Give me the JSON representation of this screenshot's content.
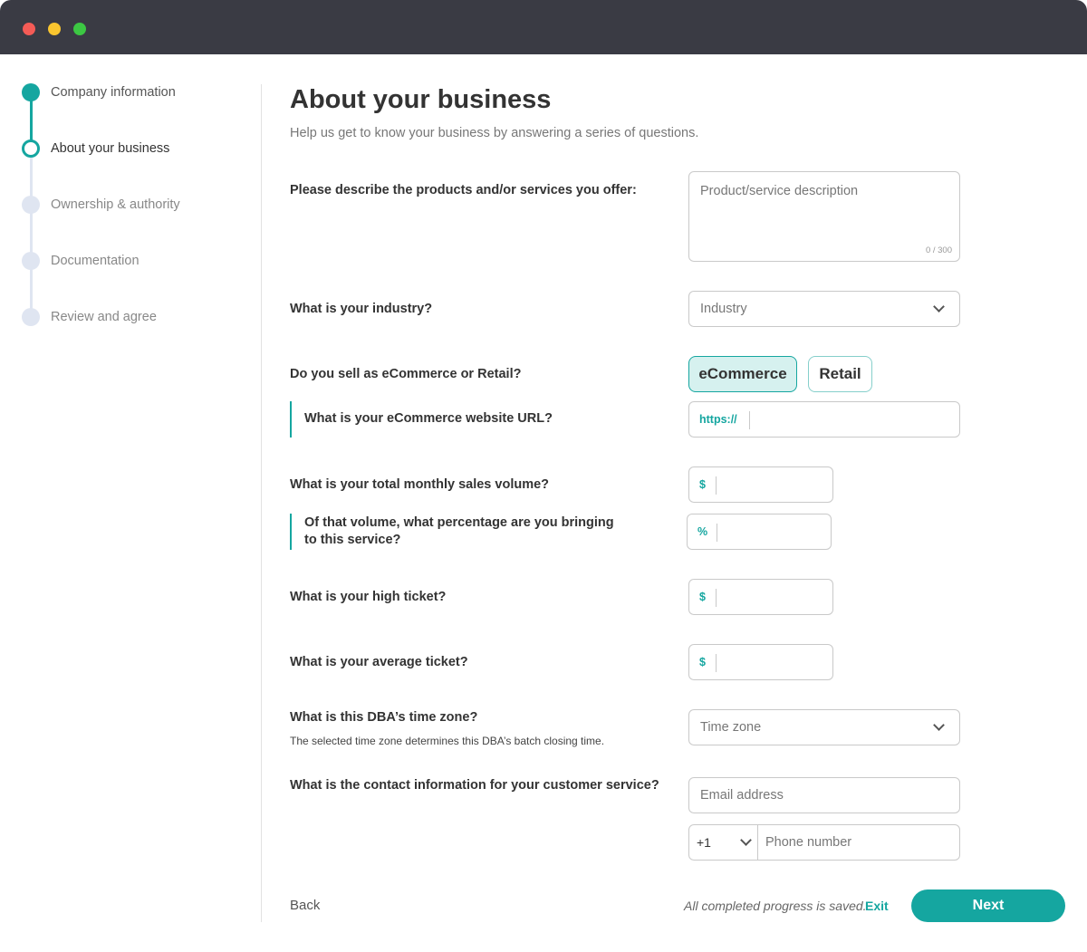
{
  "steps": [
    {
      "label": "Company information",
      "state": "done"
    },
    {
      "label": "About your business",
      "state": "current"
    },
    {
      "label": "Ownership & authority",
      "state": "todo"
    },
    {
      "label": "Documentation",
      "state": "todo"
    },
    {
      "label": "Review and agree",
      "state": "todo"
    }
  ],
  "page": {
    "title": "About your business",
    "subtitle": "Help us get to know your business by answering a series of questions."
  },
  "questions": {
    "products": "Please describe the products and/or services you offer:",
    "industry": "What is your industry?",
    "channel": "Do you sell as eCommerce or Retail?",
    "url": "What is your eCommerce website URL?",
    "monthly_volume": "What is your total monthly sales volume?",
    "percentage_line1": "Of that volume, what percentage are you bringing",
    "percentage_line2": "to this service?",
    "high_ticket": "What is your high ticket?",
    "average_ticket": "What is your average ticket?",
    "timezone": "What is this DBA’s time zone?",
    "timezone_hint": "The selected time zone determines this DBA’s batch closing time.",
    "contact": "What is the contact information for your customer service?"
  },
  "fields": {
    "description_placeholder": "Product/service description",
    "description_counter": "0 / 300",
    "industry_placeholder": "Industry",
    "toggle_ecommerce": "eCommerce",
    "toggle_retail": "Retail",
    "url_prefix": "https://",
    "currency_prefix": "$",
    "percent_prefix": "%",
    "timezone_placeholder": "Time zone",
    "email_placeholder": "Email address",
    "country_code": "+1",
    "phone_placeholder": "Phone number"
  },
  "footer": {
    "back": "Back",
    "saved": "All completed progress is saved.",
    "exit": "Exit",
    "next": "Next"
  },
  "colors": {
    "accent": "#15a6a0",
    "titlebar": "#3a3b44"
  }
}
